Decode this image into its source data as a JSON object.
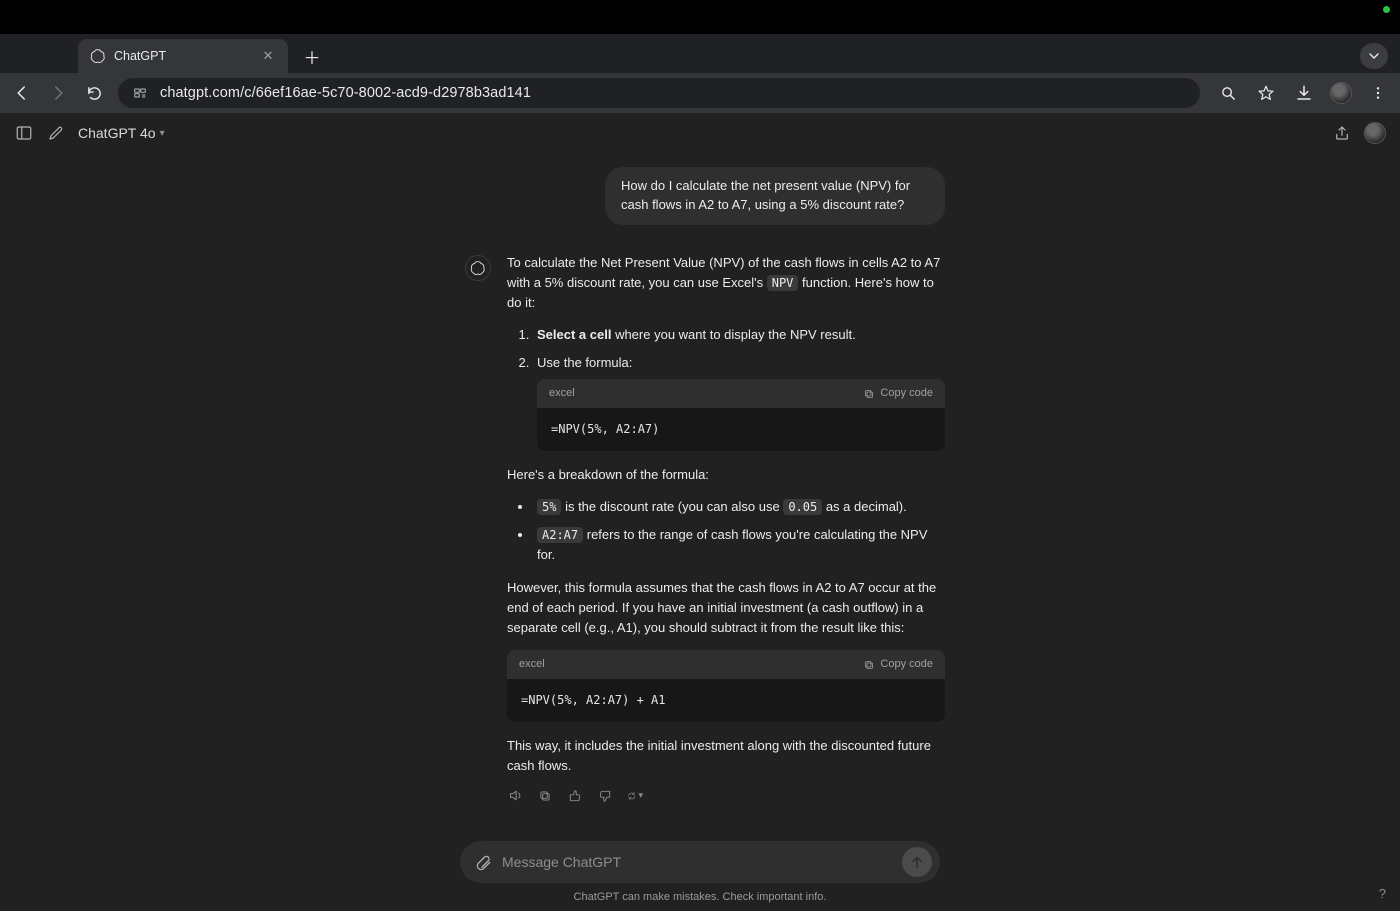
{
  "browser": {
    "tab_title": "ChatGPT",
    "url": "chatgpt.com/c/66ef16ae-5c70-8002-acd9-d2978b3ad141"
  },
  "app_header": {
    "model": "ChatGPT 4o"
  },
  "conversation": {
    "user_message": "How do I calculate the net present value (NPV) for cash flows in A2 to A7, using a 5% discount rate?",
    "assistant": {
      "intro_a": "To calculate the Net Present Value (NPV) of the cash flows in cells A2 to A7 with a 5% discount rate, you can use Excel's ",
      "intro_code": "NPV",
      "intro_b": " function. Here's how to do it:",
      "step1_strong": "Select a cell",
      "step1_rest": " where you want to display the NPV result.",
      "step2": "Use the formula:",
      "code1_lang": "excel",
      "copy_label": "Copy code",
      "code1": "=NPV(5%, A2:A7)",
      "breakdown_intro": "Here's a breakdown of the formula:",
      "b1_code": "5%",
      "b1_mid": " is the discount rate (you can also use ",
      "b1_code2": "0.05",
      "b1_end": " as a decimal).",
      "b2_code": "A2:A7",
      "b2_rest": " refers to the range of cash flows you're calculating the NPV for.",
      "however": "However, this formula assumes that the cash flows in A2 to A7 occur at the end of each period. If you have an initial investment (a cash outflow) in a separate cell (e.g., A1), you should subtract it from the result like this:",
      "code2_lang": "excel",
      "code2": "=NPV(5%, A2:A7) + A1",
      "closing": "This way, it includes the initial investment along with the discounted future cash flows."
    }
  },
  "composer": {
    "placeholder": "Message ChatGPT"
  },
  "footer": {
    "disclaimer": "ChatGPT can make mistakes. Check important info."
  }
}
